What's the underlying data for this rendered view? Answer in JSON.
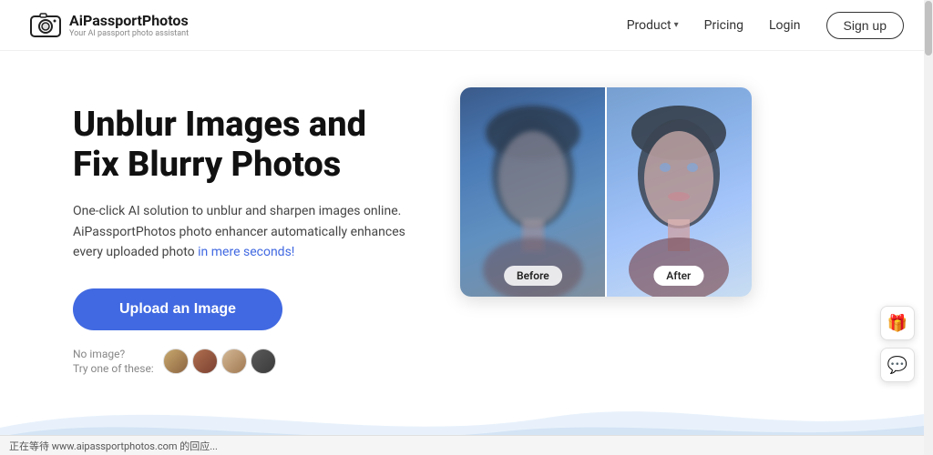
{
  "brand": {
    "name": "AiPassportPhotos",
    "tagline": "Your AI passport photo assistant",
    "logo_alt": "camera-icon"
  },
  "nav": {
    "product_label": "Product",
    "pricing_label": "Pricing",
    "login_label": "Login",
    "signup_label": "Sign up"
  },
  "hero": {
    "headline_line1": "Unblur Images and",
    "headline_line2": "Fix Blurry Photos",
    "description_1": "One-click AI solution to unblur and sharpen images online.",
    "description_2": "AiPassportPhotos photo enhancer automatically enhances",
    "description_3": "every uploaded photo ",
    "description_highlight": "in mere seconds!",
    "cta_label": "Upload an Image",
    "no_image_label": "No image?",
    "try_label": "Try one of these:"
  },
  "before_after": {
    "before_label": "Before",
    "after_label": "After"
  },
  "floating": {
    "gift_icon": "🎁",
    "chat_icon": "💬"
  },
  "status_bar": {
    "text": "正在等待 www.aipassportphotos.com 的回应..."
  }
}
